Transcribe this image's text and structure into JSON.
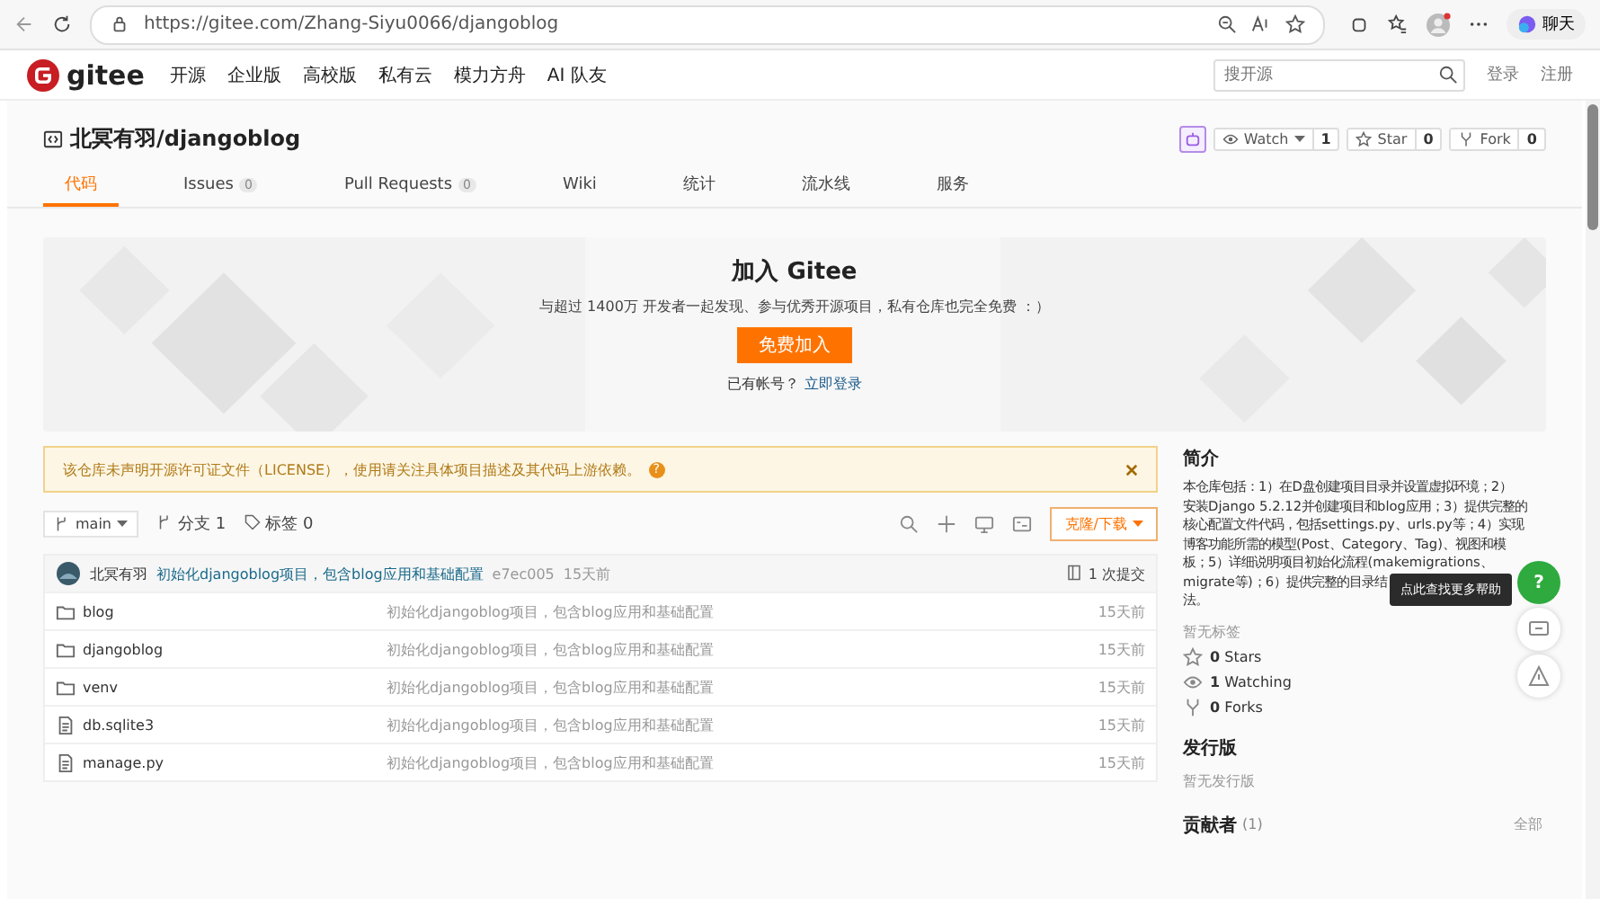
{
  "browser": {
    "url": "https://gitee.com/Zhang-Siyu0066/djangoblog",
    "chat": "聊天"
  },
  "nav": {
    "logo": "gitee",
    "items": [
      "开源",
      "企业版",
      "高校版",
      "私有云",
      "模力方舟",
      "AI 队友"
    ],
    "search_placeholder": "搜开源",
    "login": "登录",
    "register": "注册"
  },
  "repo": {
    "title": "北冥有羽/djangoblog",
    "watch": "Watch",
    "watch_count": "1",
    "star": "Star",
    "star_count": "0",
    "fork": "Fork",
    "fork_count": "0"
  },
  "tabs": [
    {
      "label": "代码",
      "selected": true
    },
    {
      "label": "Issues",
      "count": "0",
      "selected": false
    },
    {
      "label": "Pull Requests",
      "count": "0",
      "selected": false
    },
    {
      "label": "Wiki",
      "selected": false
    },
    {
      "label": "统计",
      "selected": false
    },
    {
      "label": "流水线",
      "selected": false
    },
    {
      "label": "服务",
      "selected": false
    }
  ],
  "banner": {
    "title": "加入 Gitee",
    "subtitle": "与超过 1400万 开发者一起发现、参与优秀开源项目，私有仓库也完全免费 ：）",
    "button": "免费加入",
    "have_account": "已有帐号？",
    "login_link": "立即登录"
  },
  "notice": {
    "text": "该仓库未声明开源许可证文件（LICENSE），使用请关注具体项目描述及其代码上游依赖。",
    "help": "?"
  },
  "toolbar": {
    "branch": "main",
    "branches": "分支 1",
    "tags": "标签 0",
    "clone": "克隆/下载"
  },
  "commit": {
    "author": "北冥有羽",
    "message": "初始化djangoblog项目，包含blog应用和基础配置",
    "hash": "e7ec005",
    "time": "15天前",
    "count": "1 次提交"
  },
  "files": [
    {
      "kind": "folder",
      "name": "blog",
      "message": "初始化djangoblog项目，包含blog应用和基础配置",
      "time": "15天前"
    },
    {
      "kind": "folder",
      "name": "djangoblog",
      "message": "初始化djangoblog项目，包含blog应用和基础配置",
      "time": "15天前"
    },
    {
      "kind": "folder",
      "name": "venv",
      "message": "初始化djangoblog项目，包含blog应用和基础配置",
      "time": "15天前"
    },
    {
      "kind": "file",
      "name": "db.sqlite3",
      "message": "初始化djangoblog项目，包含blog应用和基础配置",
      "time": "15天前"
    },
    {
      "kind": "file",
      "name": "manage.py",
      "message": "初始化djangoblog项目，包含blog应用和基础配置",
      "time": "15天前"
    }
  ],
  "sidebar": {
    "intro_title": "简介",
    "description_lines": [
      "本仓库包括：1）在D盘创建项目目录并设置虚拟环境；2）",
      "安装Django 5.2.12并创建项目和blog应用；3）提供完整的",
      "核心配置文件代码，包括settings.py、urls.py等；4）实现",
      "博客功能所需的模型(Post、Category、Tag)、视图和模",
      "板；5）详细说明项目初始化流程(makemigrations、",
      "migrate等)；6）提供完整的目录结"
    ],
    "description_end": "法。",
    "no_tags": "暂无标签",
    "stats": [
      {
        "kind": "star",
        "count": "0",
        "label": "Stars"
      },
      {
        "kind": "watch",
        "count": "1",
        "label": "Watching"
      },
      {
        "kind": "fork",
        "count": "0",
        "label": "Forks"
      }
    ],
    "releases_title": "发行版",
    "no_releases": "暂无发行版",
    "contributors_title": "贡献者",
    "contributors_count": "(1)",
    "all": "全部"
  },
  "help_tooltip": "点此查找更多帮助",
  "help_button": "?"
}
